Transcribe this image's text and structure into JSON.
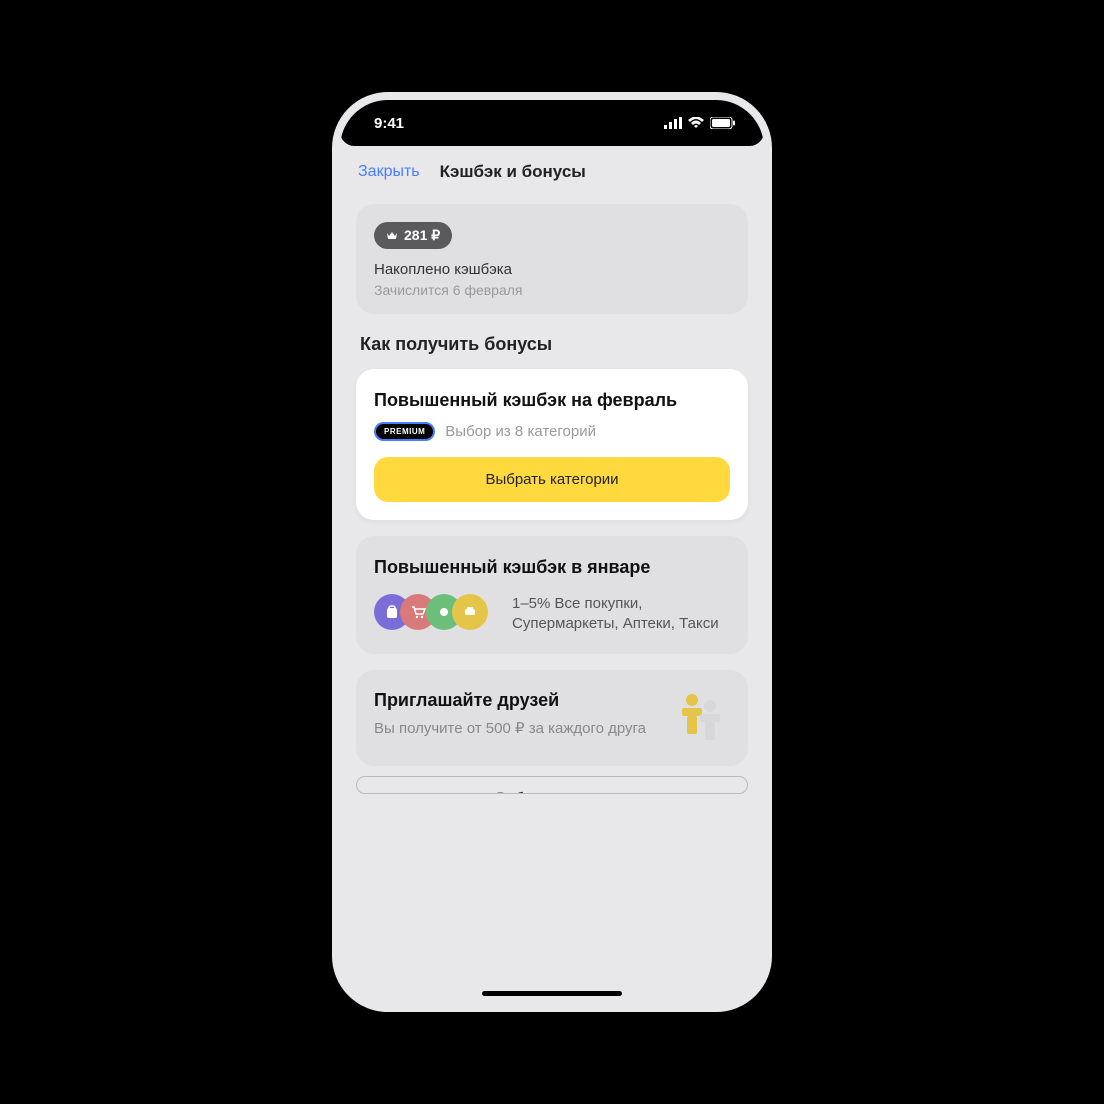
{
  "statusbar": {
    "time": "9:41"
  },
  "navbar": {
    "close": "Закрыть",
    "title": "Кэшбэк и бонусы"
  },
  "balance": {
    "amount": "281 ₽",
    "label": "Накоплено кэшбэка",
    "sub": "Зачислится 6 февраля"
  },
  "section_title": "Как получить бонусы",
  "promo": {
    "title": "Повышенный кэшбэк на февраль",
    "premium_badge": "PREMIUM",
    "subtitle": "Выбор из 8 категорий",
    "button": "Выбрать категории"
  },
  "january": {
    "title": "Повышенный кэшбэк в январе",
    "desc": "1–5% Все покупки, Супермаркеты, Аптеки, Такси"
  },
  "invite": {
    "title": "Приглашайте друзей",
    "desc": "Вы получите от 500 ₽ за каждого друга"
  },
  "cutoff_button": "Выбрать продукт"
}
